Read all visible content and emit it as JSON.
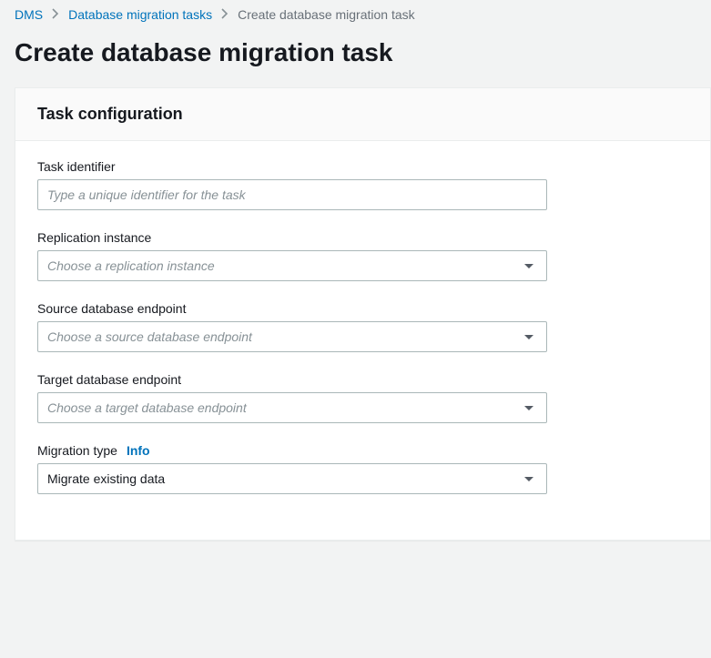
{
  "breadcrumb": {
    "items": [
      {
        "label": "DMS"
      },
      {
        "label": "Database migration tasks"
      }
    ],
    "current": "Create database migration task"
  },
  "page_title": "Create database migration task",
  "panel": {
    "title": "Task configuration",
    "fields": {
      "task_identifier": {
        "label": "Task identifier",
        "placeholder": "Type a unique identifier for the task",
        "value": ""
      },
      "replication_instance": {
        "label": "Replication instance",
        "placeholder": "Choose a replication instance",
        "value": ""
      },
      "source_endpoint": {
        "label": "Source database endpoint",
        "placeholder": "Choose a source database endpoint",
        "value": ""
      },
      "target_endpoint": {
        "label": "Target database endpoint",
        "placeholder": "Choose a target database endpoint",
        "value": ""
      },
      "migration_type": {
        "label": "Migration type",
        "info_label": "Info",
        "value": "Migrate existing data"
      }
    }
  }
}
